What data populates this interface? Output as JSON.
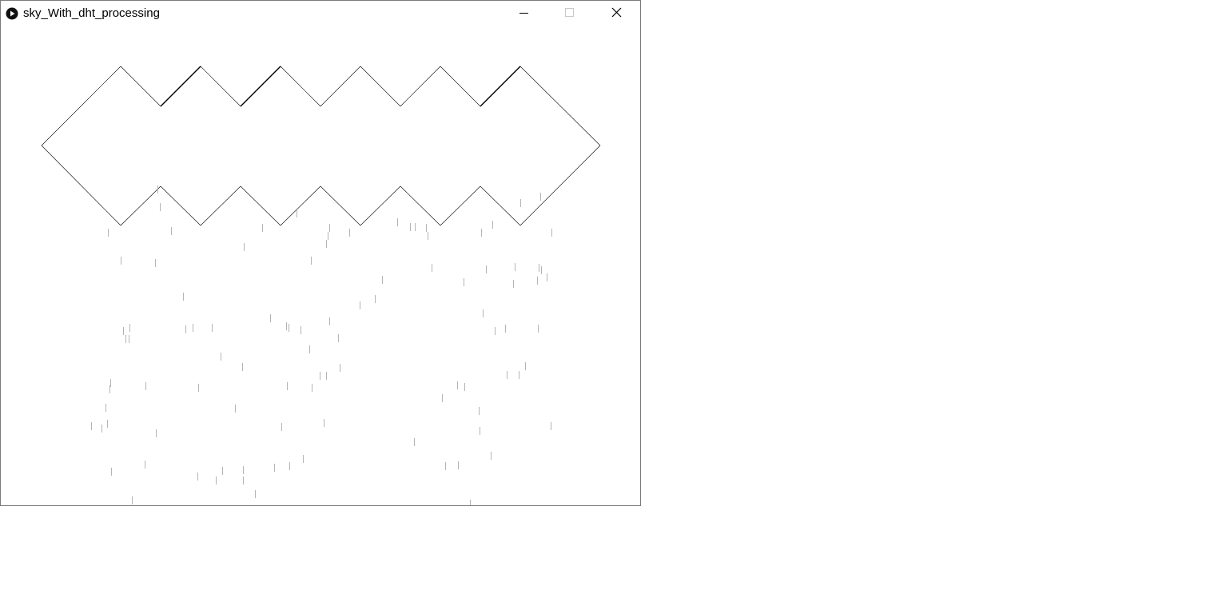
{
  "window": {
    "title": "sky_With_dht_processing",
    "icons": {
      "app": "processing-run-icon",
      "minimize": "minimize-icon",
      "maximize": "maximize-icon",
      "close": "close-icon"
    }
  },
  "sketch": {
    "cloud_color": "#000000",
    "rain_color": "#b4b4b4",
    "background": "#ffffff"
  }
}
